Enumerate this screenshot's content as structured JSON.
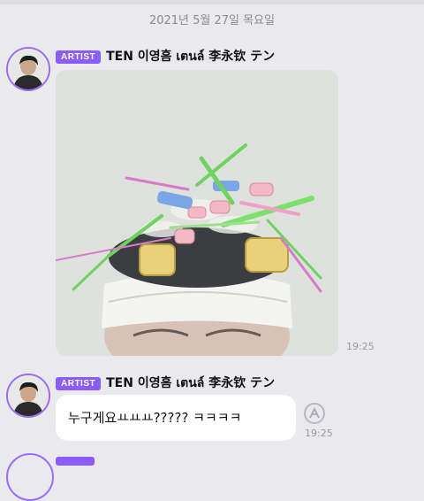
{
  "date_divider": "2021년 5월 27일 목요일",
  "messages": [
    {
      "badge": "ARTIST",
      "sender": "TEN 이영흠 เตนล์ 李永钦 テン",
      "type": "image",
      "time": "19:25"
    },
    {
      "badge": "ARTIST",
      "sender": "TEN 이영흠 เตนล์ 李永钦 テン",
      "type": "text",
      "text": "누구게요ㅛㅛㅛ????? ㅋㅋㅋㅋ",
      "time": "19:25",
      "action_icon": "translate-icon"
    }
  ],
  "colors": {
    "background": "#e9e9ee",
    "badge": "#8b5cf6",
    "avatar_ring": "#9b6bff",
    "bubble": "#ffffff"
  }
}
